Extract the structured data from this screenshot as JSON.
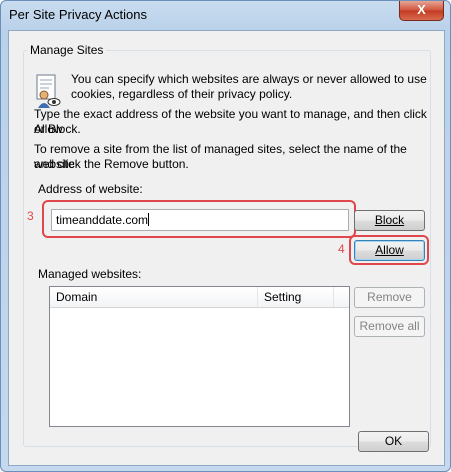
{
  "window": {
    "title": "Per Site Privacy Actions",
    "close_glyph": "X"
  },
  "group": {
    "legend": "Manage Sites",
    "intro_line1": "You can specify which websites are always or never allowed to use",
    "intro_line2": "cookies, regardless of their privacy policy.",
    "instr1_line1": "Type the exact address of the website you want to manage, and then click Allow",
    "instr1_line2": "or Block.",
    "instr2_line1": "To remove a site from the list of managed sites, select the name of the website",
    "instr2_line2": "and click the Remove button."
  },
  "address": {
    "label": "Address of website:",
    "value": "timeanddate.com"
  },
  "buttons": {
    "block": "Block",
    "allow": "Allow",
    "remove": "Remove",
    "remove_all": "Remove all",
    "ok": "OK"
  },
  "managed": {
    "label": "Managed websites:",
    "columns": [
      "Domain",
      "Setting"
    ]
  },
  "annotations": {
    "step3": "3",
    "step4": "4",
    "color": "#e0474c"
  },
  "icons": {
    "privacy": "privacy-shield-document-icon",
    "close": "close-icon"
  }
}
